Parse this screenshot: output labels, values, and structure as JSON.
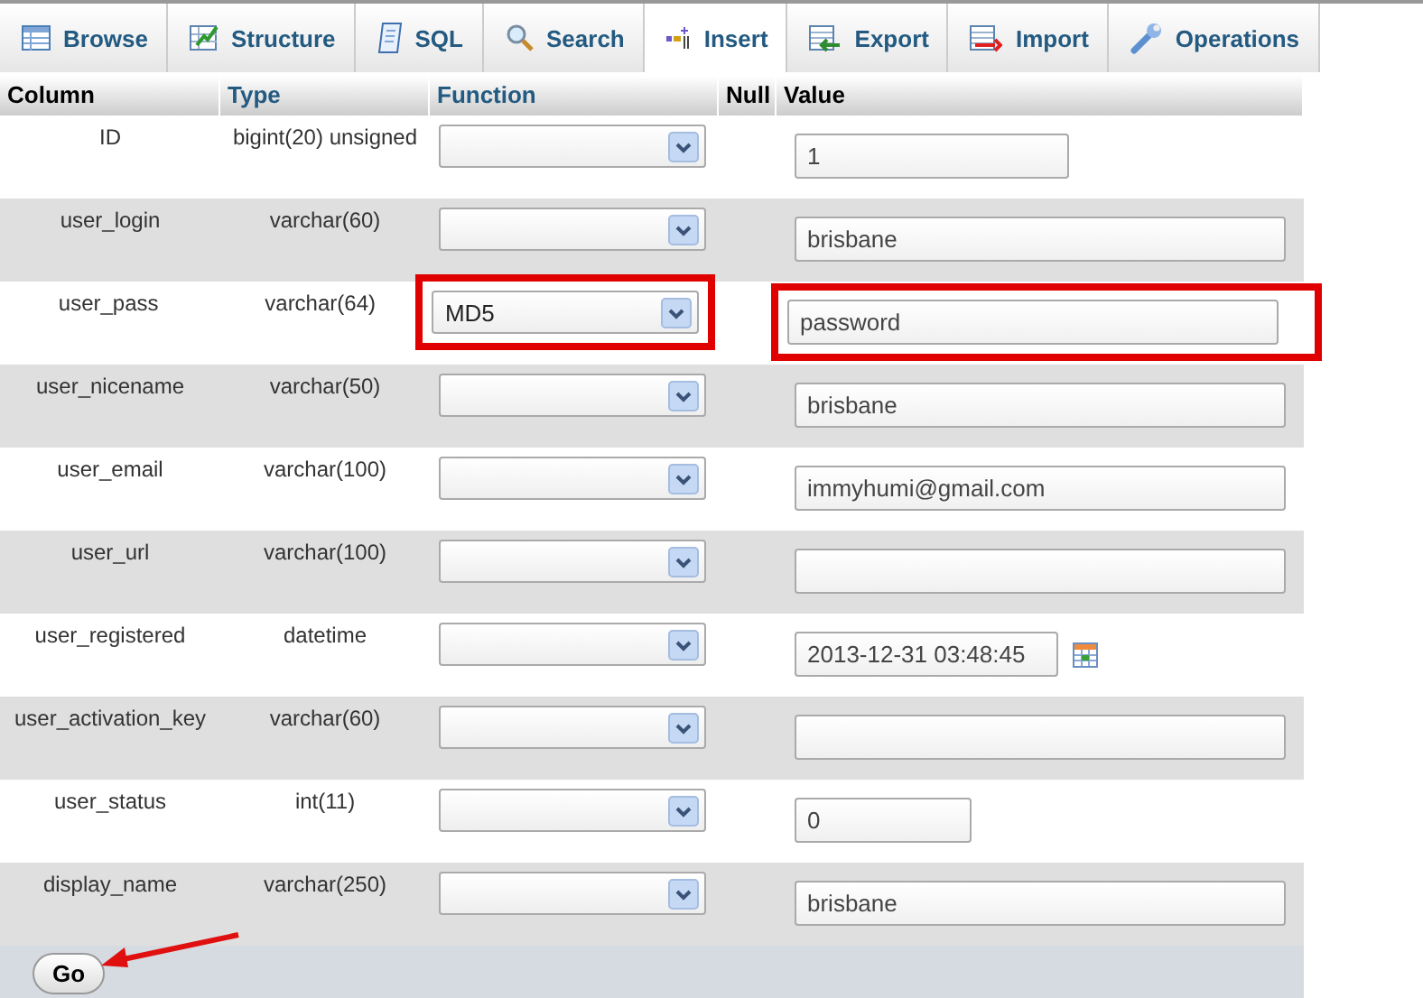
{
  "tabs": [
    {
      "label": "Browse",
      "selected": false
    },
    {
      "label": "Structure",
      "selected": false
    },
    {
      "label": "SQL",
      "selected": false
    },
    {
      "label": "Search",
      "selected": false
    },
    {
      "label": "Insert",
      "selected": true
    },
    {
      "label": "Export",
      "selected": false
    },
    {
      "label": "Import",
      "selected": false
    },
    {
      "label": "Operations",
      "selected": false
    }
  ],
  "table": {
    "columns": [
      "Column",
      "Type",
      "Function",
      "Null",
      "Value"
    ],
    "rows": [
      {
        "column": "ID",
        "type": "bigint(20) unsigned",
        "function": "",
        "value": "1",
        "kind": "medium",
        "highlighted": false
      },
      {
        "column": "user_login",
        "type": "varchar(60)",
        "function": "",
        "value": "brisbane",
        "kind": "long",
        "highlighted": false
      },
      {
        "column": "user_pass",
        "type": "varchar(64)",
        "function": "MD5",
        "value": "password",
        "kind": "long",
        "highlighted": true
      },
      {
        "column": "user_nicename",
        "type": "varchar(50)",
        "function": "",
        "value": "brisbane",
        "kind": "long",
        "highlighted": false
      },
      {
        "column": "user_email",
        "type": "varchar(100)",
        "function": "",
        "value": "immyhumi@gmail.com",
        "kind": "long",
        "highlighted": false
      },
      {
        "column": "user_url",
        "type": "varchar(100)",
        "function": "",
        "value": "",
        "kind": "long",
        "highlighted": false
      },
      {
        "column": "user_registered",
        "type": "datetime",
        "function": "",
        "value": "2013-12-31 03:48:45",
        "kind": "datetime",
        "highlighted": false
      },
      {
        "column": "user_activation_key",
        "type": "varchar(60)",
        "function": "",
        "value": "",
        "kind": "long",
        "highlighted": false
      },
      {
        "column": "user_status",
        "type": "int(11)",
        "function": "",
        "value": "0",
        "kind": "short",
        "highlighted": false
      },
      {
        "column": "display_name",
        "type": "varchar(250)",
        "function": "",
        "value": "brisbane",
        "kind": "long",
        "highlighted": false
      }
    ]
  },
  "go_button": "Go"
}
